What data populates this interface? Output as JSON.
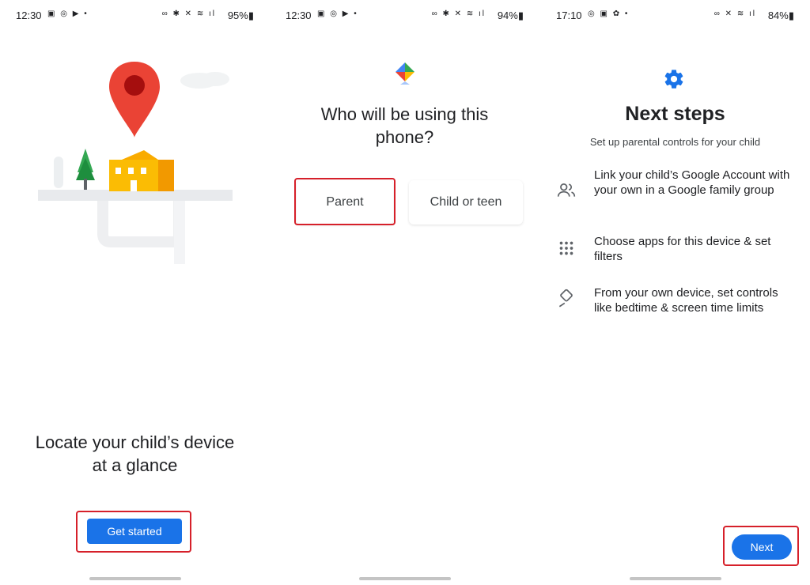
{
  "screens": [
    {
      "status": {
        "time": "12:30",
        "notif_icons": "▣ ◎ ▶ •",
        "sys_icons": "∞ ✱ ✕ ≋ ıl",
        "battery": "95%▮"
      },
      "title_lines": [
        "Locate your child’s device",
        "at a glance"
      ],
      "button": "Get started"
    },
    {
      "status": {
        "time": "12:30",
        "notif_icons": "▣ ◎ ▶ •",
        "sys_icons": "∞ ✱ ✕ ≋ ıl",
        "battery": "94%▮"
      },
      "title_lines": [
        "Who will be using this",
        "phone?"
      ],
      "options": [
        "Parent",
        "Child or teen"
      ]
    },
    {
      "status": {
        "time": "17:10",
        "notif_icons": "◎ ▣ ✿ •",
        "sys_icons": "∞ ✕ ≋ ıl",
        "battery": "84%▮"
      },
      "title": "Next steps",
      "subtitle": "Set up parental controls for your child",
      "steps": [
        {
          "icon": "people-icon",
          "text": "Link your child’s Google Account with your own in a Google family group"
        },
        {
          "icon": "apps-grid-icon",
          "text": "Choose apps for this device & set filters"
        },
        {
          "icon": "bedtime-controls-icon",
          "text": "From your own device, set controls like bedtime & screen time limits"
        }
      ],
      "button": "Next"
    }
  ],
  "colors": {
    "primary": "#1a73e8",
    "highlight": "#d6202a",
    "pin": "#ea4335",
    "house": "#fbbc04"
  }
}
